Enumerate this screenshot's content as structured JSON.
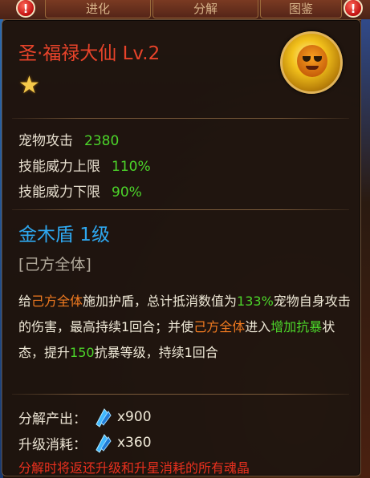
{
  "tabs": [
    {
      "label": "进化"
    },
    {
      "label": "分解"
    },
    {
      "label": "图鉴"
    }
  ],
  "alert_icons": [
    {
      "glyph": "!"
    },
    {
      "glyph": "!"
    }
  ],
  "pet": {
    "name": "圣·福禄大仙 Lv.2",
    "stars": "★"
  },
  "stats": [
    {
      "label": "宠物攻击",
      "value": "2380"
    },
    {
      "label": "技能威力上限",
      "value": "110%"
    },
    {
      "label": "技能威力下限",
      "value": "90%"
    }
  ],
  "skill": {
    "name": "金木盾 1级",
    "target": "[己方全体]",
    "desc": {
      "p1": "给",
      "h1": "己方全体",
      "p2": "施加护盾，总计抵消数值为",
      "h2": "133%",
      "p3": "宠物自身攻击的伤害，最高持续1回合；并使",
      "h3": "己方全体",
      "p4": "进入",
      "h4": "增加抗暴",
      "p5": "状态，提升",
      "h5": "150",
      "p6": "抗暴等级，持续1回合"
    }
  },
  "costs": [
    {
      "label": "分解产出：",
      "value": "x900",
      "icon": "soul-crystal-icon"
    },
    {
      "label": "升级消耗：",
      "value": "x360",
      "icon": "soul-crystal-icon"
    }
  ],
  "footer_note": "分解时将返还升级和升星消耗的所有魂晶",
  "colors": {
    "name_red": "#e8432a",
    "value_green": "#4cd52a",
    "skill_blue": "#2ea8f0",
    "highlight_orange": "#f07a20",
    "note_red": "#e8301e"
  }
}
